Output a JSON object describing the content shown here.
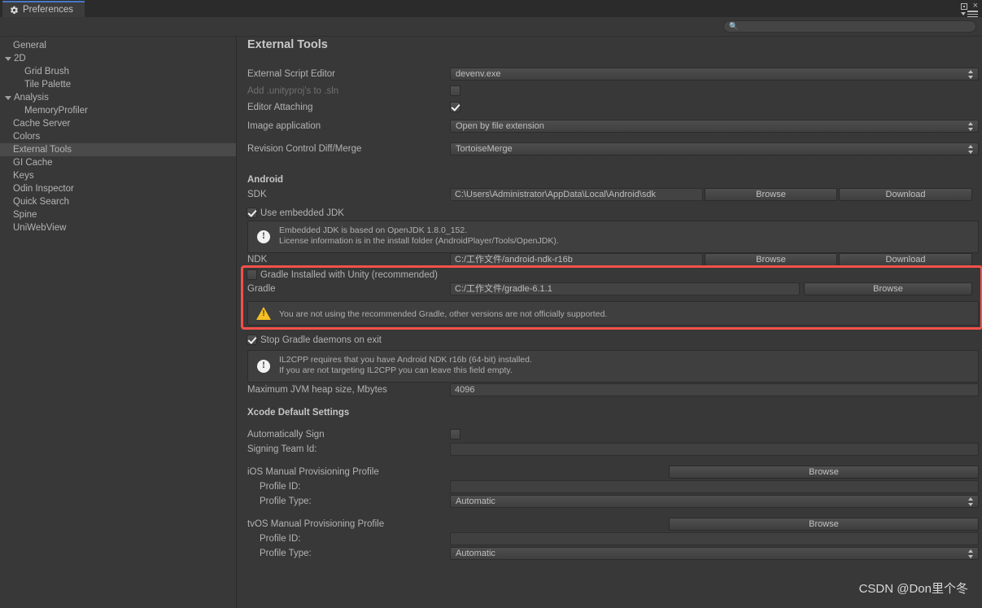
{
  "window": {
    "tab_label": "Preferences",
    "tab_icon": "gear-icon",
    "maximize_label": "□",
    "close_label": "×"
  },
  "search": {
    "value": "",
    "placeholder": "",
    "icon": "search-icon"
  },
  "sidebar": {
    "items": [
      {
        "label": "General",
        "indent": 0,
        "expand": false,
        "selected": false
      },
      {
        "label": "2D",
        "indent": 0,
        "expand": true,
        "selected": false
      },
      {
        "label": "Grid Brush",
        "indent": 1,
        "expand": false,
        "selected": false
      },
      {
        "label": "Tile Palette",
        "indent": 1,
        "expand": false,
        "selected": false
      },
      {
        "label": "Analysis",
        "indent": 0,
        "expand": true,
        "selected": false
      },
      {
        "label": "MemoryProfiler",
        "indent": 1,
        "expand": false,
        "selected": false
      },
      {
        "label": "Cache Server",
        "indent": 0,
        "expand": false,
        "selected": false
      },
      {
        "label": "Colors",
        "indent": 0,
        "expand": false,
        "selected": false
      },
      {
        "label": "External Tools",
        "indent": 0,
        "expand": false,
        "selected": true
      },
      {
        "label": "GI Cache",
        "indent": 0,
        "expand": false,
        "selected": false
      },
      {
        "label": "Keys",
        "indent": 0,
        "expand": false,
        "selected": false
      },
      {
        "label": "Odin Inspector",
        "indent": 0,
        "expand": false,
        "selected": false
      },
      {
        "label": "Quick Search",
        "indent": 0,
        "expand": false,
        "selected": false
      },
      {
        "label": "Spine",
        "indent": 0,
        "expand": false,
        "selected": false
      },
      {
        "label": "UniWebView",
        "indent": 0,
        "expand": false,
        "selected": false
      }
    ]
  },
  "main": {
    "title": "External Tools",
    "external_script_editor": {
      "label": "External Script Editor",
      "value": "devenv.exe"
    },
    "add_unityproj": {
      "label": "Add .unityproj's to .sln",
      "checked": false
    },
    "editor_attaching": {
      "label": "Editor Attaching",
      "checked": true
    },
    "image_application": {
      "label": "Image application",
      "value": "Open by file extension"
    },
    "revision_control": {
      "label": "Revision Control Diff/Merge",
      "value": "TortoiseMerge"
    },
    "android": {
      "heading": "Android",
      "sdk": {
        "label": "SDK",
        "value": "C:\\Users\\Administrator\\AppData\\Local\\Android\\sdk",
        "browse": "Browse",
        "download": "Download"
      },
      "use_embedded_jdk": {
        "label": "Use embedded JDK",
        "checked": true
      },
      "jdk_info": "Embedded JDK is based on OpenJDK 1.8.0_152.\nLicense information is in the install folder (AndroidPlayer/Tools/OpenJDK).",
      "ndk": {
        "label": "NDK",
        "value": "C:/工作文件/android-ndk-r16b",
        "browse": "Browse",
        "download": "Download"
      },
      "gradle_with_unity": {
        "label": "Gradle Installed with Unity (recommended)",
        "checked": false
      },
      "gradle": {
        "label": "Gradle",
        "value": "C:/工作文件/gradle-6.1.1",
        "browse": "Browse"
      },
      "gradle_warning": "You are not using the recommended Gradle, other versions are not officially supported.",
      "stop_gradle_daemons": {
        "label": "Stop Gradle daemons on exit",
        "checked": true
      },
      "il2cpp_info": "IL2CPP requires that you have Android NDK r16b (64-bit) installed.\nIf you are not targeting IL2CPP you can leave this field empty.",
      "max_jvm_heap": {
        "label": "Maximum JVM heap size, Mbytes",
        "value": "4096"
      }
    },
    "xcode": {
      "heading": "Xcode Default Settings",
      "automatically_sign": {
        "label": "Automatically Sign",
        "checked": false
      },
      "signing_team_id": {
        "label": "Signing Team Id:",
        "value": ""
      },
      "ios_profile": {
        "label": "iOS Manual Provisioning Profile",
        "browse": "Browse"
      },
      "ios_profile_id": {
        "label": "Profile ID:",
        "value": ""
      },
      "ios_profile_type": {
        "label": "Profile Type:",
        "value": "Automatic"
      },
      "tvos_profile": {
        "label": "tvOS Manual Provisioning Profile",
        "browse": "Browse"
      },
      "tvos_profile_id": {
        "label": "Profile ID:",
        "value": ""
      },
      "tvos_profile_type": {
        "label": "Profile Type:",
        "value": "Automatic"
      }
    }
  },
  "watermark": {
    "text": "CSDN @Don里个冬"
  },
  "colors": {
    "background": "#383838",
    "accent_tab": "#4b77c4",
    "highlight_red": "#f4504a",
    "warning_yellow": "#f4c024",
    "selection": "#4a4a4a"
  }
}
